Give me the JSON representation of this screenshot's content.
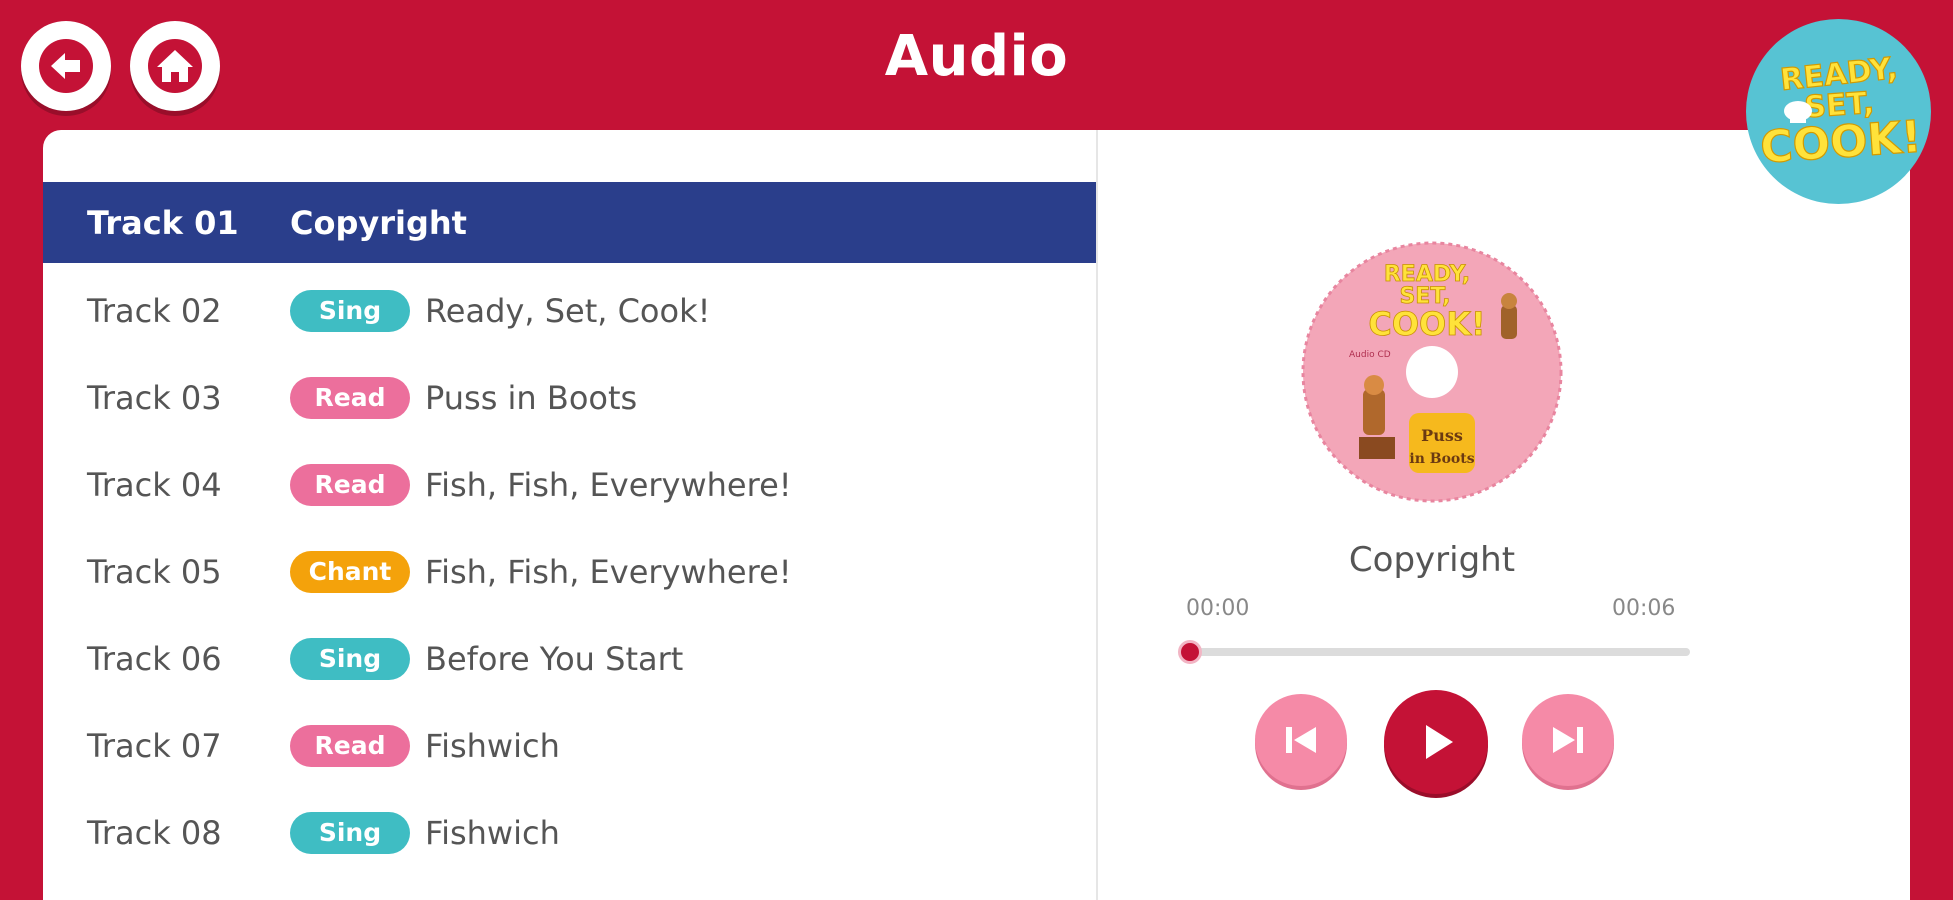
{
  "header": {
    "title": "Audio",
    "back_icon": "back-arrow-icon",
    "home_icon": "home-icon",
    "logo_text": "READY, SET, COOK!"
  },
  "tracks": [
    {
      "number": "Track 01",
      "badge": "",
      "badge_type": "",
      "title": "Copyright",
      "active": true
    },
    {
      "number": "Track 02",
      "badge": "Sing",
      "badge_type": "sing",
      "title": "Ready, Set, Cook!",
      "active": false
    },
    {
      "number": "Track 03",
      "badge": "Read",
      "badge_type": "read",
      "title": "Puss in Boots",
      "active": false
    },
    {
      "number": "Track 04",
      "badge": "Read",
      "badge_type": "read",
      "title": "Fish, Fish, Everywhere!",
      "active": false
    },
    {
      "number": "Track 05",
      "badge": "Chant",
      "badge_type": "chant",
      "title": "Fish, Fish, Everywhere!",
      "active": false
    },
    {
      "number": "Track 06",
      "badge": "Sing",
      "badge_type": "sing",
      "title": "Before You Start",
      "active": false
    },
    {
      "number": "Track 07",
      "badge": "Read",
      "badge_type": "read",
      "title": "Fishwich",
      "active": false
    },
    {
      "number": "Track 08",
      "badge": "Sing",
      "badge_type": "sing",
      "title": "Fishwich",
      "active": false
    }
  ],
  "player": {
    "now_playing": "Copyright",
    "time_current": "00:00",
    "time_total": "00:06",
    "progress": 0.0,
    "cd_text": {
      "title": "READY, SET, COOK!",
      "subtitle": "Puss in Boots",
      "label": "Audio CD"
    },
    "controls": {
      "prev_icon": "skip-previous-icon",
      "play_icon": "play-icon",
      "next_icon": "skip-next-icon"
    }
  },
  "colors": {
    "brand_red": "#c41236",
    "active_row": "#2a3e8b",
    "sing": "#3fbdc3",
    "read": "#ec6f9c",
    "chant": "#f4a20b",
    "logo_bg": "#57c3d3"
  }
}
